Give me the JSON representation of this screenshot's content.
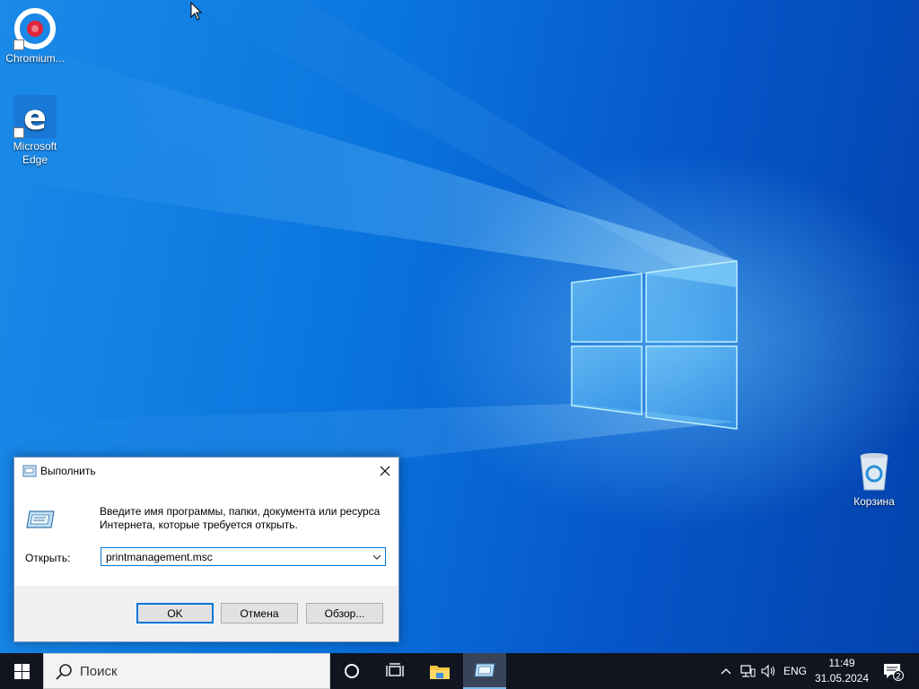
{
  "desktop": {
    "icons": [
      {
        "label": "Chromium..."
      },
      {
        "label": "Microsoft Edge"
      },
      {
        "label": "Корзина"
      }
    ]
  },
  "run_dialog": {
    "title": "Выполнить",
    "description": "Введите имя программы, папки, документа или ресурса Интернета, которые требуется открыть.",
    "open_label": "Открыть:",
    "open_value": "printmanagement.msc",
    "ok_label": "OK",
    "cancel_label": "Отмена",
    "browse_label": "Обзор..."
  },
  "taskbar": {
    "search_placeholder": "Поиск",
    "language": "ENG",
    "time": "11:49",
    "date": "31.05.2024",
    "notification_count": "2"
  },
  "colors": {
    "accent": "#0078d7",
    "taskbar": "#101520"
  }
}
